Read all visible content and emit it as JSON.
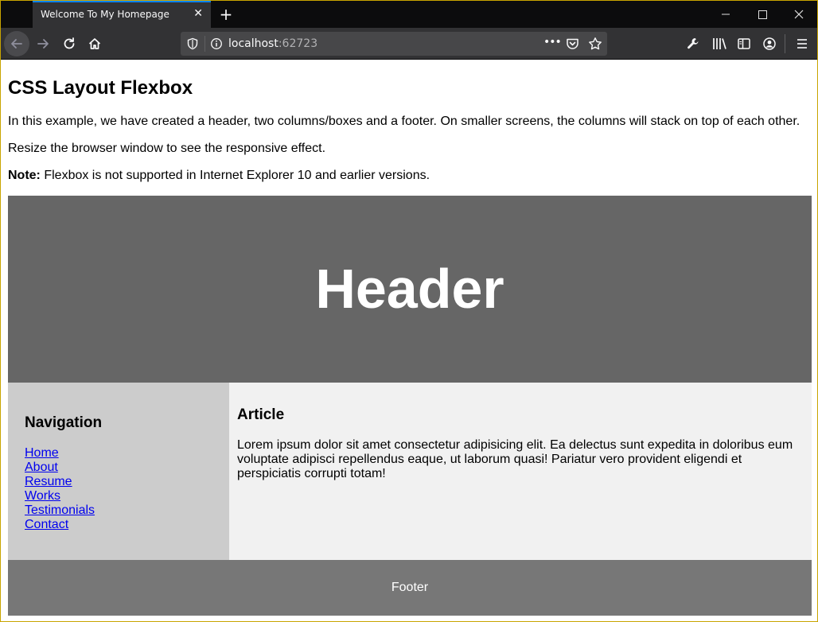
{
  "browser": {
    "tab_title": "Welcome To My Homepage",
    "url_host": "localhost",
    "url_port": ":62723",
    "page_actions_glyph": "•••"
  },
  "page": {
    "title": "CSS Layout Flexbox",
    "intro": "In this example, we have created a header, two columns/boxes and a footer. On smaller screens, the columns will stack on top of each other.",
    "resize_note": "Resize the browser window to see the responsive effect.",
    "note_label": "Note:",
    "note_text": " Flexbox is not supported in Internet Explorer 10 and earlier versions.",
    "header_text": "Header",
    "nav": {
      "heading": "Navigation",
      "links": [
        "Home",
        "About",
        "Resume",
        "Works",
        "Testimonials",
        "Contact"
      ]
    },
    "article": {
      "heading": "Article",
      "body": "Lorem ipsum dolor sit amet consectetur adipisicing elit. Ea delectus sunt expedita in doloribus eum voluptate adipisci repellendus eaque, ut laborum quasi! Pariatur vero provident eligendi et perspiciatis corrupti totam!"
    },
    "footer_text": "Footer"
  },
  "colors": {
    "header_bg": "#666666",
    "nav_bg": "#cccccc",
    "article_bg": "#f1f1f1",
    "footer_bg": "#777777",
    "link": "#0000ee"
  },
  "icons": [
    "back-icon",
    "forward-icon",
    "reload-icon",
    "home-icon",
    "tracking-shield-icon",
    "info-icon",
    "pocket-icon",
    "bookmark-star-icon",
    "wrench-icon",
    "library-icon",
    "sidebar-icon",
    "account-icon",
    "menu-icon",
    "minimize-icon",
    "maximize-icon",
    "close-window-icon"
  ]
}
